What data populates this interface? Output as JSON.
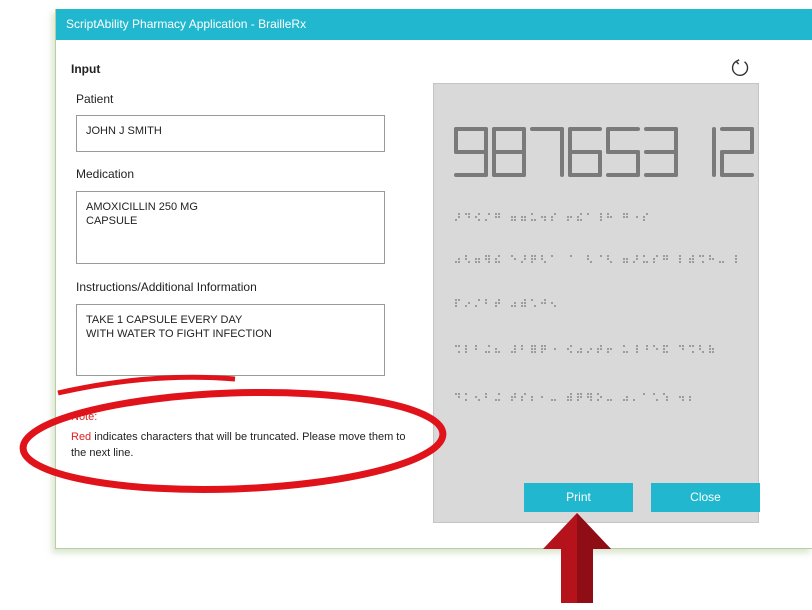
{
  "window": {
    "title": "ScriptAbility Pharmacy Application - BrailleRx"
  },
  "input": {
    "heading": "Input",
    "patient_label": "Patient",
    "patient_value": "JOHN J SMITH",
    "medication_label": "Medication",
    "medication_lines": [
      "AMOXICILLIN 250 MG",
      "CAPSULE"
    ],
    "instructions_label": "Instructions/Additional Information",
    "instructions_lines": [
      "TAKE 1 CAPSULE EVERY DAY",
      "WITH WATER TO FIGHT INFECTION"
    ]
  },
  "note": {
    "title": "Note:",
    "red_word": "Red",
    "text": "indicates characters that will be truncated. Please move them to the next line."
  },
  "preview": {
    "rx_number": "98765312"
  },
  "buttons": {
    "print": "Print",
    "close": "Close"
  },
  "icons": {
    "refresh": "refresh-icon",
    "arrow": "arrow-up-icon"
  },
  "colors": {
    "accent": "#21b8cf",
    "highlight": "#e0131b",
    "arrow": "#b5121b",
    "preview_bg": "#d9d9d9"
  }
}
